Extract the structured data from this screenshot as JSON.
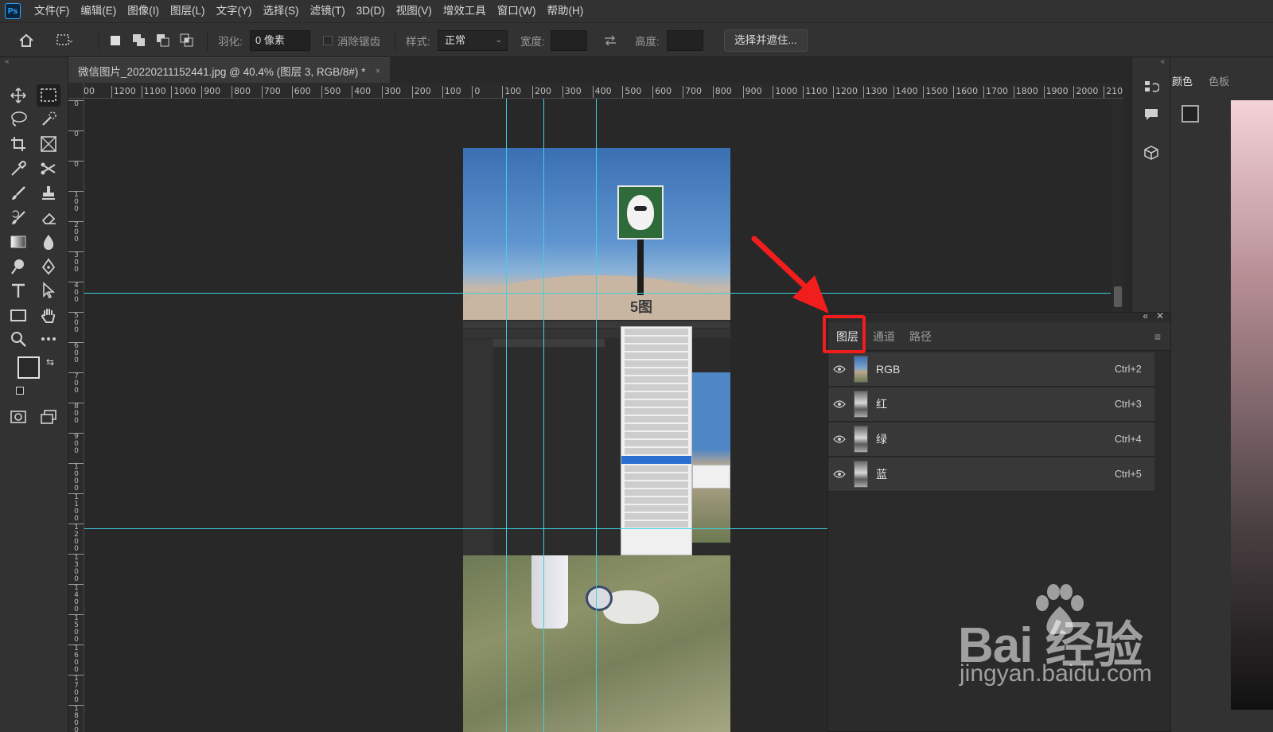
{
  "app": {
    "logo": "Ps"
  },
  "menu": [
    "文件(F)",
    "编辑(E)",
    "图像(I)",
    "图层(L)",
    "文字(Y)",
    "选择(S)",
    "滤镜(T)",
    "3D(D)",
    "视图(V)",
    "增效工具",
    "窗口(W)",
    "帮助(H)"
  ],
  "options": {
    "feather_label": "羽化:",
    "feather_value": "0 像素",
    "antialias_label": "消除锯齿",
    "style_label": "样式:",
    "style_value": "正常",
    "width_label": "宽度:",
    "height_label": "高度:",
    "select_mask_button": "选择并遮住..."
  },
  "document": {
    "tab_title": "微信图片_20220211152441.jpg @ 40.4% (图层 3, RGB/8#) *",
    "close": "×"
  },
  "ruler": {
    "horizontal": [
      "00",
      "1200",
      "1100",
      "1000",
      "900",
      "800",
      "700",
      "600",
      "500",
      "400",
      "300",
      "200",
      "100",
      "0",
      "100",
      "200",
      "300",
      "400",
      "500",
      "600",
      "700",
      "800",
      "900",
      "1000",
      "1100",
      "1200",
      "1300",
      "1400",
      "1500",
      "1600",
      "1700",
      "1800",
      "1900",
      "2000",
      "210"
    ],
    "vertical": [
      "0",
      "0",
      "0",
      "1 0 0",
      "2 0 0",
      "3 0 0",
      "4 0 0",
      "5 0 0",
      "6 0 0",
      "7 0 0",
      "8 0 0",
      "9 0 0",
      "1 0 0 0",
      "1 1 0 0",
      "1 2 0 0",
      "1 3 0 0",
      "1 4 0 0",
      "1 5 0 0",
      "1 6 0 0",
      "1 7 0 0",
      "1 8 0 0"
    ]
  },
  "image": {
    "sign_text": "5图"
  },
  "right_panel": {
    "tabs": [
      "颜色",
      "色板"
    ]
  },
  "channels_panel": {
    "tabs": [
      "图层",
      "通道",
      "路径"
    ],
    "active_tab": "图层",
    "rows": [
      {
        "name": "RGB",
        "shortcut": "Ctrl+2"
      },
      {
        "name": "红",
        "shortcut": "Ctrl+3"
      },
      {
        "name": "绿",
        "shortcut": "Ctrl+4"
      },
      {
        "name": "蓝",
        "shortcut": "Ctrl+5"
      }
    ]
  },
  "watermark": {
    "main": "Bai  经验",
    "sub": "jingyan.baidu.com"
  },
  "colors": {
    "guide": "#3fd1e0",
    "highlight": "#f21d1d",
    "accent": "#31a8ff"
  }
}
